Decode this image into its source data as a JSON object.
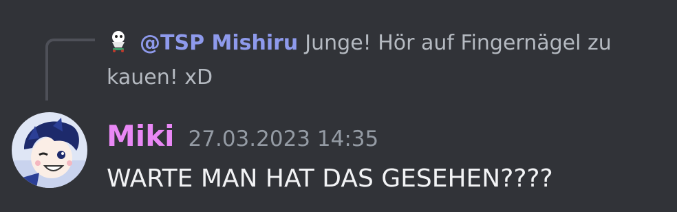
{
  "reply": {
    "author_mention": "@TSP Mishiru",
    "text": "Junge! Hör auf Fingernägel zu kauen! xD",
    "avatar_icon": "ghost-skater-avatar-icon"
  },
  "message": {
    "author": "Miki",
    "timestamp": "27.03.2023 14:35",
    "content": "WARTE MAN HAT DAS GESEHEN????",
    "avatar_icon": "anime-boy-avatar-icon"
  },
  "colors": {
    "background": "#313338",
    "mention": "#8e9aec",
    "author": "#e988f5",
    "timestamp": "#949ba4",
    "text": "#f2f3f5",
    "reply_text": "#b5bac1"
  }
}
